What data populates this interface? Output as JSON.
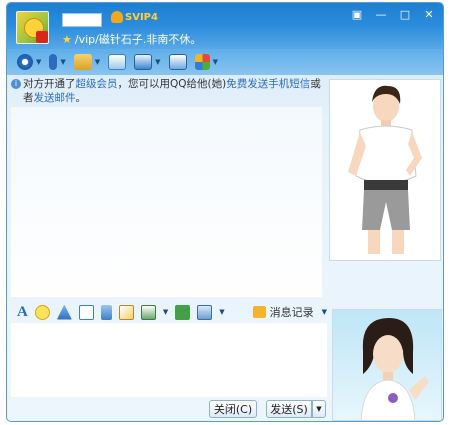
{
  "header": {
    "badge": "SVIP4",
    "signature": "/vip/磁针石子.非南不休。"
  },
  "window_controls": {
    "skin": "▣",
    "minimize": "—",
    "maximize": "□",
    "close": "✕"
  },
  "notice": {
    "part1": "对方开通了",
    "link1": "超级会员",
    "part2": "，您可以用QQ给他(她)",
    "link2": "免费发送手机短信",
    "part3": "或者",
    "link3": "发送邮件",
    "part4": "。",
    "close": "✕"
  },
  "input_toolbar": {
    "font_glyph": "A",
    "history_label": "消息记录"
  },
  "buttons": {
    "close": "关闭(C)",
    "send": "发送(S)",
    "more_arrow": "▼"
  },
  "colors": {
    "title_bar": "#2c8cdc",
    "link": "#2c6cc0",
    "badge": "#ffd03c"
  }
}
